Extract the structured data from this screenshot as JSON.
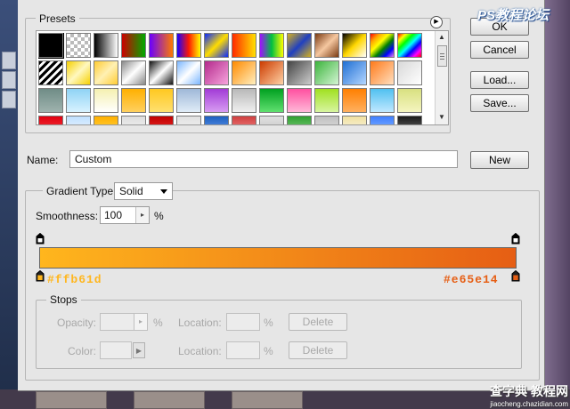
{
  "dialog": {
    "presets_title": "Presets",
    "menu_icon": "triangle-right-icon",
    "buttons": {
      "ok": "OK",
      "cancel": "Cancel",
      "load": "Load...",
      "save": "Save...",
      "new": "New"
    },
    "name_label": "Name:",
    "name_value": "Custom"
  },
  "gradient": {
    "type_label": "Gradient Type:",
    "type_value": "Solid",
    "smoothness_label": "Smoothness:",
    "smoothness_value": "100",
    "smoothness_unit": "%",
    "start_color": "#ffb61d",
    "end_color": "#e65e14",
    "left_stop_label": "#ffb61d",
    "right_stop_label": "#e65e14"
  },
  "stops": {
    "title": "Stops",
    "opacity_label": "Opacity:",
    "opacity_unit": "%",
    "opacity_location_label": "Location:",
    "opacity_location_unit": "%",
    "opacity_delete": "Delete",
    "color_label": "Color:",
    "color_location_label": "Location:",
    "color_location_unit": "%",
    "color_delete": "Delete"
  },
  "watermark": {
    "top": "PS教程论坛",
    "bottom": "查字典 教程网",
    "bottom_url": "jiaocheng.chazidian.com"
  }
}
